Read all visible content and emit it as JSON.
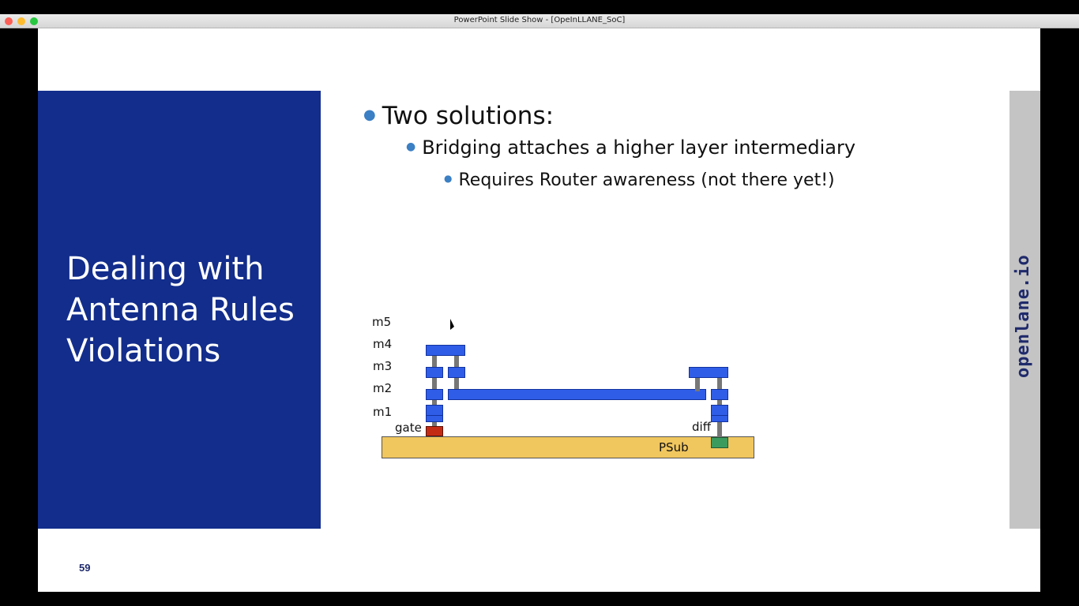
{
  "window": {
    "title": "PowerPoint Slide Show - [OpeInLLANE_SoC]"
  },
  "slide": {
    "title_lines": [
      "Dealing with",
      "Antenna Rules",
      "Violations"
    ],
    "bullets": {
      "level1": "Two solutions:",
      "level2": "Bridging attaches a higher layer intermediary",
      "level3": "Requires Router awareness (not there yet!)"
    },
    "brand": "openlane.io",
    "number": "59"
  },
  "diagram": {
    "layers": [
      "m5",
      "m4",
      "m3",
      "m2",
      "m1"
    ],
    "gate_label": "gate",
    "diff_label": "diff",
    "substrate_label": "PSub"
  },
  "colors": {
    "panel": "#122d8b",
    "metal": "#2f5de8",
    "gate": "#c42b15",
    "diff": "#3b9b5f",
    "substrate": "#f0c65e"
  }
}
